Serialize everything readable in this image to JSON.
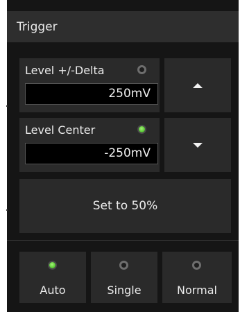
{
  "title": "Trigger",
  "level_delta": {
    "label": "Level +/-Delta",
    "value": "250mV",
    "indicator": "off"
  },
  "level_center": {
    "label": "Level Center",
    "value": "-250mV",
    "indicator": "on"
  },
  "arrows": {
    "up": "arrow-up-icon",
    "down": "arrow-down-icon"
  },
  "set50_label": "Set to 50%",
  "modes": [
    {
      "label": "Auto",
      "indicator": "on"
    },
    {
      "label": "Single",
      "indicator": "off"
    },
    {
      "label": "Normal",
      "indicator": "off"
    }
  ],
  "colors": {
    "indicator_on": "#5fcf3a",
    "panel": "#151515",
    "tile": "#2a2a2a"
  }
}
